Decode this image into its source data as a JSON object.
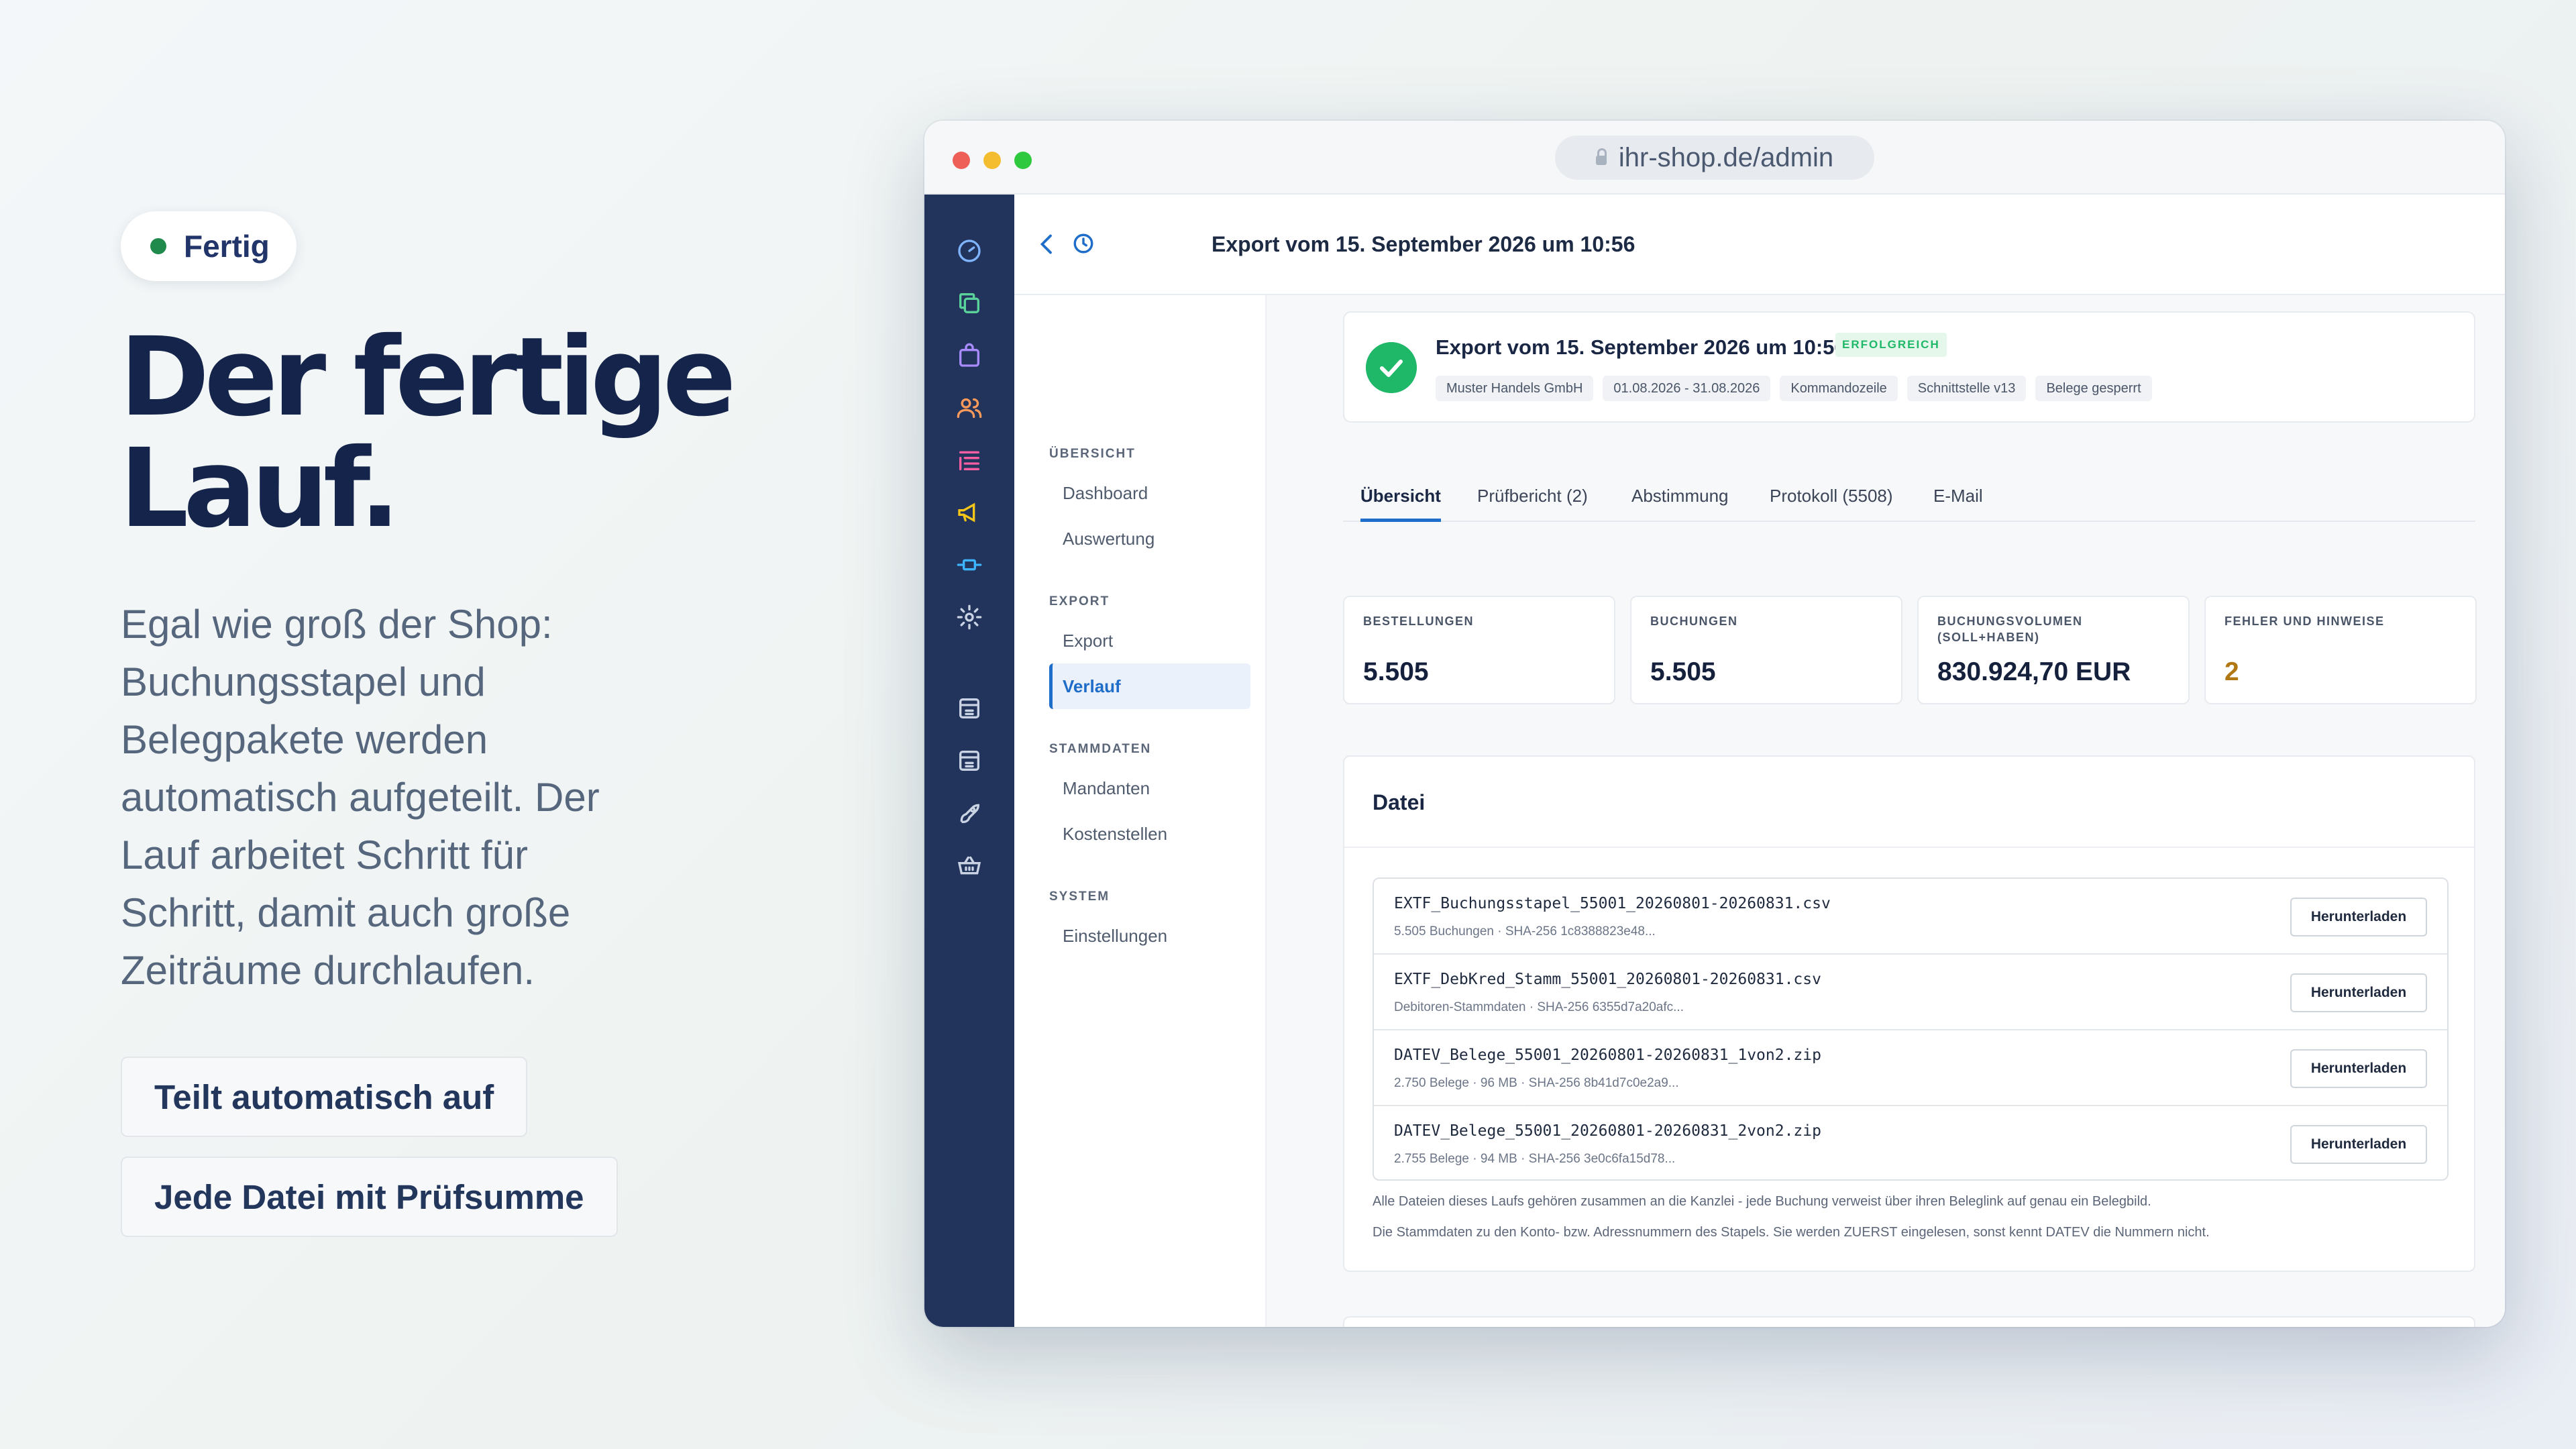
{
  "hero": {
    "badge": "Fertig",
    "headline_line1": "Der fertige",
    "headline_line2": "Lauf.",
    "lead_lines": [
      "Egal wie groß der Shop:",
      "Buchungsstapel und",
      "Belegpakete werden",
      "automatisch aufgeteilt. Der",
      "Lauf arbeitet Schritt für",
      "Schritt, damit auch große",
      "Zeiträume durchlaufen."
    ],
    "pill_1": "Teilt automatisch auf",
    "pill_2": "Jede Datei mit Prüfsumme"
  },
  "browser": {
    "url": "ihr-shop.de/admin"
  },
  "rail_icons": [
    "gauge-icon",
    "copy-icon",
    "bag-icon",
    "users-icon",
    "list-icon",
    "megaphone-icon",
    "plug-icon",
    "gear-icon",
    "store-icon",
    "store-icon-2",
    "rocket-icon",
    "basket-icon"
  ],
  "page": {
    "title": "Export vom 15. September 2026 um 10:56"
  },
  "subnav": {
    "sections": [
      {
        "label": "ÜBERSICHT",
        "items": [
          "Dashboard",
          "Auswertung"
        ]
      },
      {
        "label": "EXPORT",
        "items": [
          "Export",
          "Verlauf"
        ]
      },
      {
        "label": "STAMMDATEN",
        "items": [
          "Mandanten",
          "Kostenstellen"
        ]
      },
      {
        "label": "SYSTEM",
        "items": [
          "Einstellungen"
        ]
      }
    ],
    "active": "Verlauf"
  },
  "summary": {
    "title": "Export vom 15. September 2026 um 10:56",
    "status": "ERFOLGREICH",
    "tags": [
      "Muster Handels GmbH",
      "01.08.2026 - 31.08.2026",
      "Kommandozeile",
      "Schnittstelle v13",
      "Belege gesperrt"
    ]
  },
  "tabs": [
    "Übersicht",
    "Prüfbericht (2)",
    "Abstimmung",
    "Protokoll (5508)",
    "E-Mail"
  ],
  "active_tab": "Übersicht",
  "stats": [
    {
      "label": "BESTELLUNGEN",
      "value": "5.505"
    },
    {
      "label": "BUCHUNGEN",
      "value": "5.505"
    },
    {
      "label": "BUCHUNGSVOLUMEN (SOLL+HABEN)",
      "value": "830.924,70 EUR"
    },
    {
      "label": "FEHLER UND HINWEISE",
      "value": "2"
    }
  ],
  "files": {
    "title": "Datei",
    "download_label": "Herunterladen",
    "rows": [
      {
        "name": "EXTF_Buchungsstapel_55001_20260801-20260831.csv",
        "meta": "5.505 Buchungen · SHA-256 1c8388823e48..."
      },
      {
        "name": "EXTF_DebKred_Stamm_55001_20260801-20260831.csv",
        "meta": "Debitoren-Stammdaten · SHA-256 6355d7a20afc..."
      },
      {
        "name": "DATEV_Belege_55001_20260801-20260831_1von2.zip",
        "meta": "2.750 Belege · 96 MB · SHA-256 8b41d7c0e2a9..."
      },
      {
        "name": "DATEV_Belege_55001_20260801-20260831_2von2.zip",
        "meta": "2.755 Belege · 94 MB · SHA-256 3e0c6fa15d78..."
      }
    ],
    "note_1": "Alle Dateien dieses Laufs gehören zusammen an die Kanzlei - jede Buchung verweist über ihren Beleglink auf genau ein Belegbild.",
    "note_2": "Die Stammdaten zu den Konto- bzw. Adressnummern des Stapels. Sie werden ZUERST eingelesen, sonst kennt DATEV die Nummern nicht."
  },
  "colors": {
    "accent": "#1e6dc8",
    "success": "#1fb868",
    "rail": "#22345c",
    "warning": "#b07712"
  }
}
